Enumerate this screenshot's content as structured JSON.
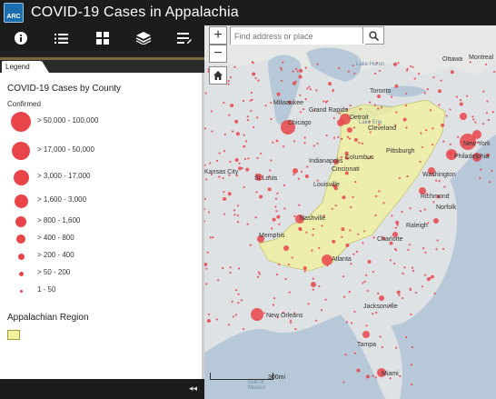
{
  "header": {
    "logo_text": "ARC",
    "title": "COVID-19 Cases in Appalachia"
  },
  "toolbar": {
    "tools": [
      "info-icon",
      "list-icon",
      "grid-icon",
      "layers-icon",
      "edit-list-icon"
    ]
  },
  "panel": {
    "tab_label": "Legend",
    "collapse_glyph": "◂◂"
  },
  "legend": {
    "heading": "COVID-19 Cases by County",
    "subheading": "Confirmed",
    "classes": [
      {
        "label": "> 50,000 - 100,000"
      },
      {
        "label": "> 17,000 - 50,000"
      },
      {
        "label": "> 3,000 - 17,000"
      },
      {
        "label": "> 1,600 - 3,000"
      },
      {
        "label": "> 800 - 1,600"
      },
      {
        "label": "> 400 - 800"
      },
      {
        "label": "> 200 - 400"
      },
      {
        "label": "> 50 - 200"
      },
      {
        "label": "1 - 50"
      }
    ],
    "region_heading": "Appalachian Region",
    "colors": {
      "cases": "#e8444a",
      "region_fill": "#f1f29a",
      "region_stroke": "#9c9c40"
    }
  },
  "map": {
    "search_placeholder": "Find address or place",
    "zoom_in": "+",
    "zoom_out": "−",
    "scale_label": "300mi",
    "cities": [
      "Ottawa",
      "Montreal",
      "Toronto",
      "Milwaukee",
      "Chicago",
      "Detroit",
      "Cleveland",
      "Pittsburgh",
      "New York",
      "Philadelphia",
      "Washington",
      "Indianapolis",
      "Columbus",
      "Cincinnati",
      "St Louis",
      "Louisville",
      "Richmond",
      "Norfolk",
      "Nashville",
      "Raleigh",
      "Memphis",
      "Charlotte",
      "Atlanta",
      "New Orleans",
      "Jacksonville",
      "Tampa",
      "Miami",
      "Grand Rapids",
      "Lake Huron",
      "Lake Erie",
      "Gulf of Mexico",
      "Kansas City"
    ]
  }
}
